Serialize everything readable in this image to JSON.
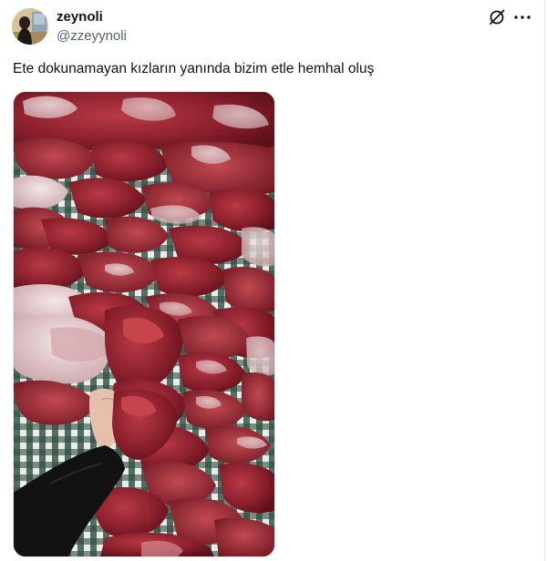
{
  "tweet": {
    "author": {
      "display_name": "zeynoli",
      "handle": "@zzeyynoli",
      "avatar_icon": "profile-photo"
    },
    "text": "Ete dokunamayan kızların yanında bizim etle hemhal oluş",
    "header_icons": [
      "grok-icon",
      "more-icon"
    ],
    "media": {
      "type": "photo",
      "icon": "raw-meat-pieces-photo"
    }
  },
  "colors": {
    "text_primary": "#0f1419",
    "text_secondary": "#536471",
    "meat": "#8b1e2b",
    "fat": "#e9d6d8",
    "tablecloth": "#1d3a2c"
  }
}
